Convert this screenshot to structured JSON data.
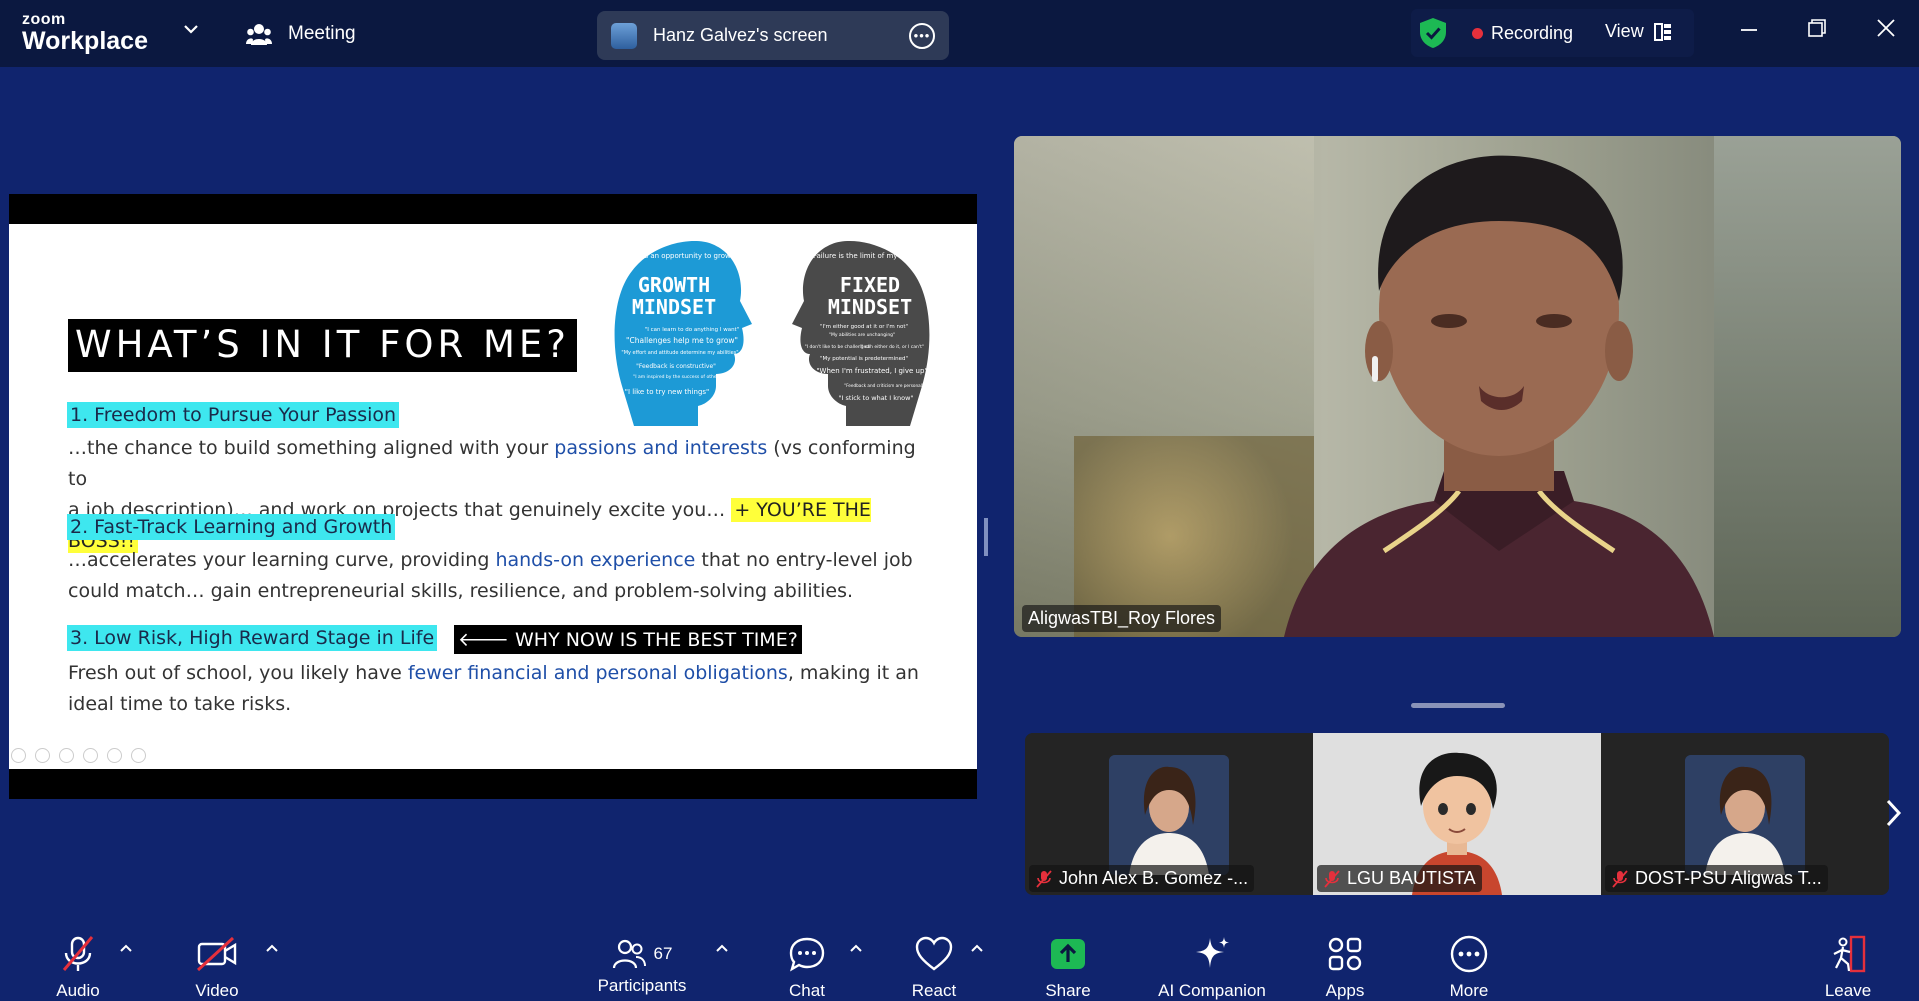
{
  "topbar": {
    "logo_line1": "zoom",
    "logo_line2": "Workplace",
    "meeting_label": "Meeting",
    "screen_title": "Hanz Galvez's screen",
    "recording_label": "Recording",
    "view_label": "View"
  },
  "slide": {
    "title": "WHAT’S IN IT FOR ME?",
    "growth": {
      "quote": "\"Failure is an opportunity to grow\"",
      "title1": "GROWTH",
      "title2": "MINDSET",
      "line_a": "\"I can learn to do anything I want\"",
      "line_b": "\"Challenges help me to grow\"",
      "line_c": "\"My effort and attitude determine my abilities\"",
      "line_d": "\"Feedback is constructive\"",
      "line_e": "\"I am inspired by the success of others\"",
      "line_f": "\"I like to try new things\""
    },
    "fixed": {
      "quote": "\"Failure is the limit of my abilities\"",
      "title1": "FIXED",
      "title2": "MINDSET",
      "line_a": "\"I'm either good at it or I'm not\"",
      "line_b": "\"My abilities are unchanging\"",
      "line_c": "\"I don't like to be challenged\"",
      "line_d": "\"I can either do it, or I can't\"",
      "line_e": "\"My potential is predetermined\"",
      "line_f": "\"When I'm frustrated, I give up\"",
      "line_g": "\"Feedback and criticism are personal\"",
      "line_h": "\"I stick to what I know\""
    },
    "p1_heading": "1. Freedom to Pursue Your Passion",
    "p1_pre": "…the chance to build something aligned with your ",
    "p1_blue": "passions and interests",
    "p1_post": " (vs conforming to",
    "p1_line2": "a job description)…  and work on projects that genuinely excite you… ",
    "p1_boss": "+ YOU’RE THE BOSS!!",
    "p2_heading": "2. Fast-Track Learning and Growth",
    "p2_pre": "…accelerates your learning curve, providing ",
    "p2_blue": "hands-on experience",
    "p2_post": " that no entry-level job",
    "p2_line2": "could match…  gain entrepreneurial skills, resilience, and problem-solving abilities.",
    "p3_heading": "3. Low Risk, High Reward Stage in Life",
    "p3_why": "WHY NOW IS THE BEST TIME?",
    "p3_pre": "Fresh out of school, you likely have ",
    "p3_blue": "fewer financial and personal obligations",
    "p3_post": ", making it an",
    "p3_line2": "ideal time to take risks."
  },
  "speaker": {
    "name": "AligwasTBI_Roy Flores"
  },
  "thumbnails": [
    {
      "name": "John Alex B. Gomez -..."
    },
    {
      "name": "LGU BAUTISTA"
    },
    {
      "name": "DOST-PSU Aligwas T..."
    }
  ],
  "toolbar": {
    "audio": "Audio",
    "video": "Video",
    "participants": "Participants",
    "participants_count": "67",
    "chat": "Chat",
    "react": "React",
    "share": "Share",
    "ai_companion": "AI Companion",
    "apps": "Apps",
    "more": "More",
    "leave": "Leave"
  },
  "colors": {
    "background": "#10246e",
    "topbar": "#0b1840",
    "highlight_cyan": "#3ee7ef",
    "highlight_yellow": "#ffff3a",
    "recording_red": "#e5303c",
    "share_green": "#1db954",
    "leave_red": "#e5303c",
    "growth_head": "#1d9ad6",
    "fixed_head": "#4a4a4a"
  }
}
